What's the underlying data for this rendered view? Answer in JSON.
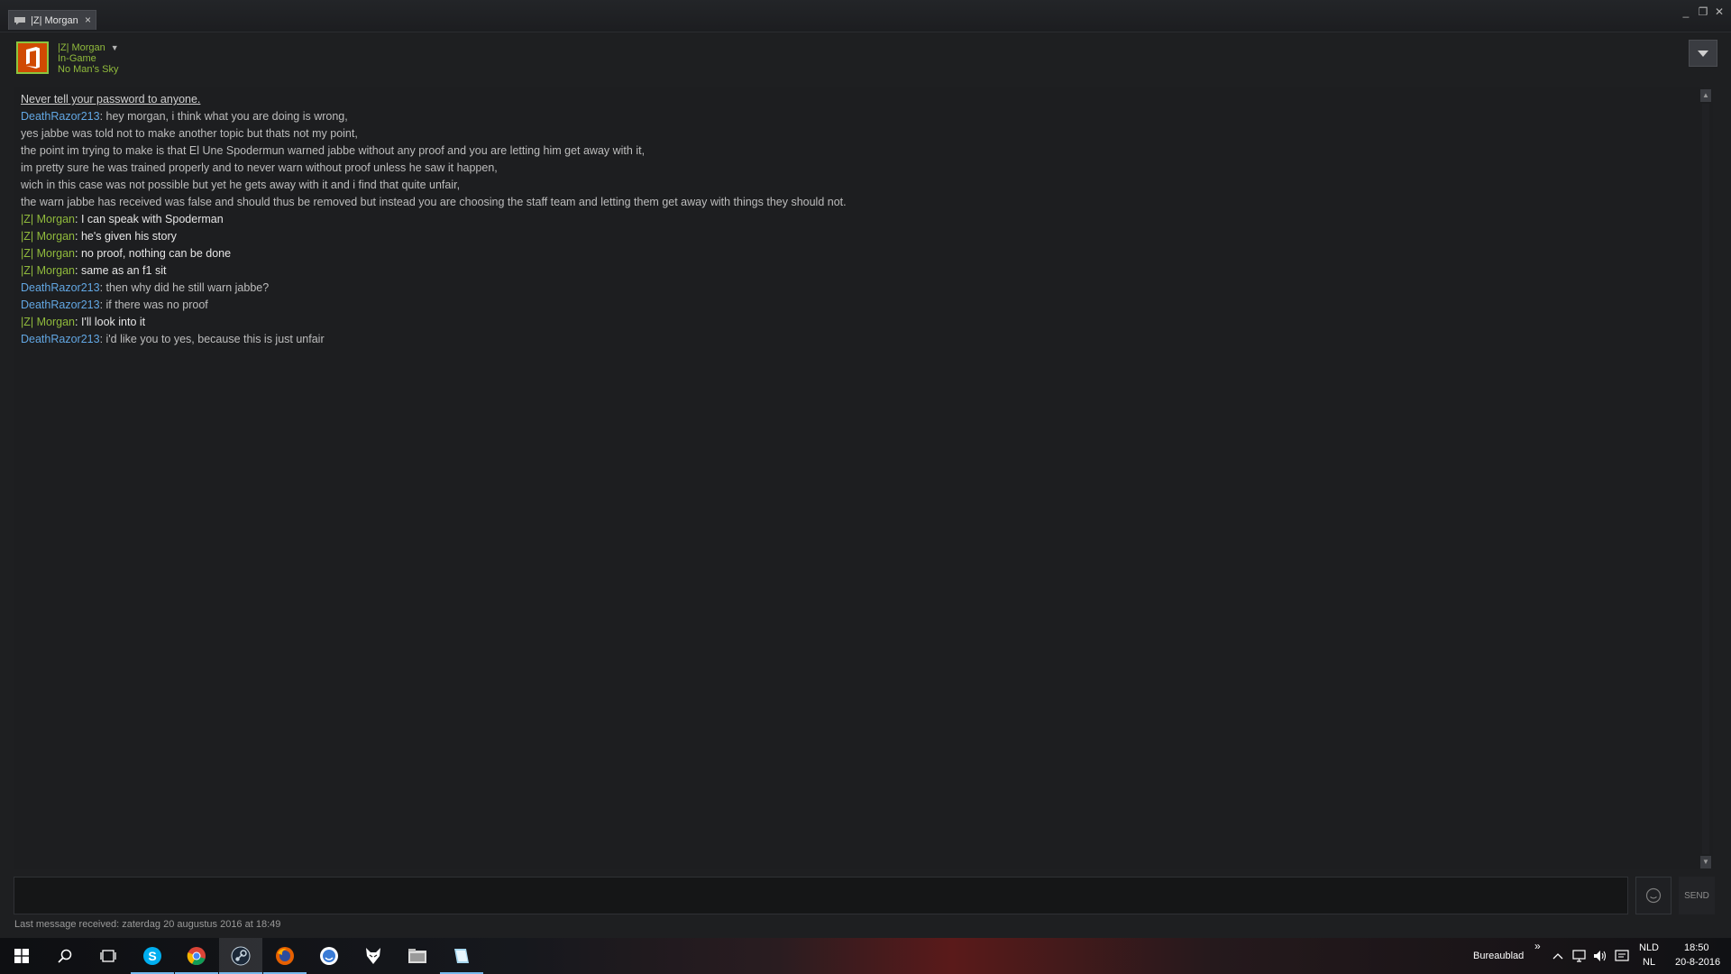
{
  "window": {
    "tab_label": "|Z| Morgan",
    "tab_close": "×",
    "minimize": "_",
    "maximize": "❐",
    "close": "✕"
  },
  "friend": {
    "name": "|Z| Morgan",
    "status": "In-Game",
    "game": "No Man's Sky",
    "caret": "▼"
  },
  "chat": {
    "warning": "Never tell your password to anyone.",
    "messages": [
      {
        "sender": "DeathRazor213",
        "separator": ": ",
        "text": "hey morgan, i think what you are doing is wrong,"
      },
      {
        "sender": "",
        "separator": "",
        "text": "yes jabbe was told not to make another topic but thats not my point,"
      },
      {
        "sender": "",
        "separator": "",
        "text": "the point im trying to make is that El Une Spodermun warned jabbe without any proof and you are letting him get away with it,"
      },
      {
        "sender": "",
        "separator": "",
        "text": "im pretty sure he was trained properly and to never warn without proof unless he saw it happen,"
      },
      {
        "sender": "",
        "separator": "",
        "text": "wich in this case was not possible but yet he gets away with it and i find that quite unfair,"
      },
      {
        "sender": "",
        "separator": "",
        "text": "the warn jabbe has received was false and should thus be removed but instead you are choosing the staff team and letting them get away with things they should not."
      },
      {
        "sender": "|Z| Morgan",
        "separator": ": ",
        "text": "I can speak with Spoderman"
      },
      {
        "sender": "|Z| Morgan",
        "separator": ": ",
        "text": "he's given his story"
      },
      {
        "sender": "|Z| Morgan",
        "separator": ": ",
        "text": "no proof, nothing can be done"
      },
      {
        "sender": "|Z| Morgan",
        "separator": ": ",
        "text": "same as an f1 sit"
      },
      {
        "sender": "DeathRazor213",
        "separator": ": ",
        "text": "then why did he still warn jabbe?"
      },
      {
        "sender": "DeathRazor213",
        "separator": ": ",
        "text": "if there was no proof"
      },
      {
        "sender": "|Z| Morgan",
        "separator": ": ",
        "text": "I'll look into it"
      },
      {
        "sender": "DeathRazor213",
        "separator": ": ",
        "text": "i'd like you to yes, because this is just unfair"
      }
    ]
  },
  "input": {
    "value": "",
    "placeholder": "",
    "send_label": "SEND"
  },
  "status_line": "Last message received: zaterdag 20 augustus 2016 at 18:49",
  "taskbar": {
    "desktop_label": "Bureaublad",
    "lang_top": "NLD",
    "lang_bottom": "NL",
    "time": "18:50",
    "date": "20-8-2016",
    "overflow": "»",
    "chevron_up": "^"
  },
  "colors": {
    "friend_green": "#90ba3c",
    "other_blue": "#62a7e3",
    "background": "#1e1f21"
  }
}
